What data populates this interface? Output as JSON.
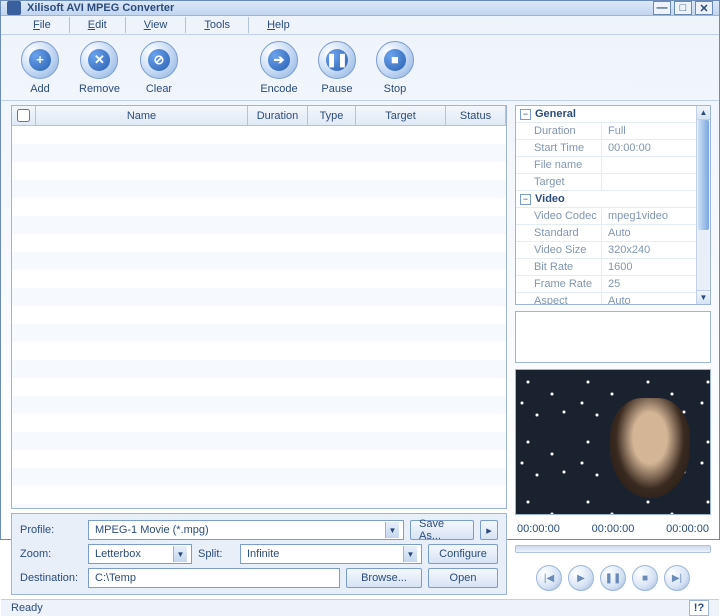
{
  "title": "Xilisoft AVI MPEG Converter",
  "menu": {
    "file": "File",
    "edit": "Edit",
    "view": "View",
    "tools": "Tools",
    "help": "Help"
  },
  "toolbar": {
    "add": "Add",
    "remove": "Remove",
    "clear": "Clear",
    "encode": "Encode",
    "pause": "Pause",
    "stop": "Stop"
  },
  "toolbar_glyphs": {
    "add": "+",
    "remove": "✕",
    "clear": "⊘",
    "encode": "➔",
    "pause": "❚❚",
    "stop": "■"
  },
  "columns": {
    "name": "Name",
    "duration": "Duration",
    "type": "Type",
    "target": "Target",
    "status": "Status"
  },
  "labels": {
    "profile": "Profile:",
    "zoom": "Zoom:",
    "split": "Split:",
    "destination": "Destination:"
  },
  "values": {
    "profile": "MPEG-1 Movie (*.mpg)",
    "zoom": "Letterbox",
    "split": "Infinite",
    "destination": "C:\\Temp"
  },
  "buttons": {
    "saveas": "Save As...",
    "configure": "Configure",
    "browse": "Browse...",
    "open": "Open",
    "more": "▸"
  },
  "props": {
    "general_head": "General",
    "general": [
      {
        "k": "Duration",
        "v": "Full"
      },
      {
        "k": "Start Time",
        "v": "00:00:00"
      },
      {
        "k": "File name",
        "v": ""
      },
      {
        "k": "Target",
        "v": ""
      }
    ],
    "video_head": "Video",
    "video": [
      {
        "k": "Video Codec",
        "v": "mpeg1video"
      },
      {
        "k": "Standard",
        "v": "Auto"
      },
      {
        "k": "Video Size",
        "v": "320x240"
      },
      {
        "k": "Bit Rate",
        "v": "1600"
      },
      {
        "k": "Frame Rate",
        "v": "25"
      },
      {
        "k": "Aspect",
        "v": "Auto"
      }
    ]
  },
  "timecodes": {
    "t1": "00:00:00",
    "t2": "00:00:00",
    "t3": "00:00:00"
  },
  "status": {
    "text": "Ready",
    "help": "!?"
  }
}
